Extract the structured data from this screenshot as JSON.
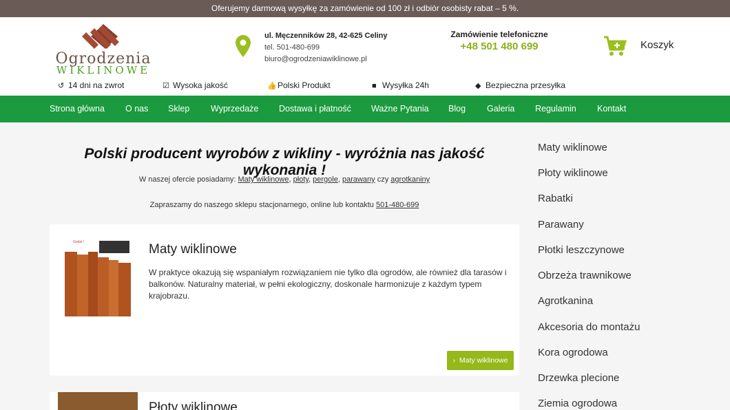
{
  "topbar": {
    "text": "Oferujemy darmową wysyłkę za zamówienie od 100 zł i odbiór osobisty rabat – 5 %."
  },
  "logo": {
    "line1": "Ogrodzenia",
    "line2": "WIKLINOWE"
  },
  "contact": {
    "address": "ul. Męczenników 28, 42-625 Celiny",
    "tel": "tel. 501-480-699",
    "email": "biuro@ogrodzeniawiklinowe.pl"
  },
  "phone": {
    "title": "Zamówienie telefoniczne",
    "number": "+48 501 480 699"
  },
  "cart": {
    "label": "Koszyk"
  },
  "features": [
    {
      "icon": "return-icon",
      "label": "14 dni na zwrot"
    },
    {
      "icon": "check-icon",
      "label": "Wysoka jakość"
    },
    {
      "icon": "thumb-up-icon",
      "label": "Polski Produkt"
    },
    {
      "icon": "truck-icon",
      "label": "Wysyłka 24h"
    },
    {
      "icon": "shield-icon",
      "label": "Bezpieczna przesyłka"
    }
  ],
  "nav": [
    "Strona główna",
    "O nas",
    "Sklep",
    "Wyprzedaże",
    "Dostawa i płatność",
    "Ważne Pytania",
    "Blog",
    "Galeria",
    "Regulamin",
    "Kontakt"
  ],
  "main": {
    "headline": "Polski producent wyrobów z wikliny - wyróżnia nas jakość wykonania !",
    "offer_prefix": "W naszej ofercie posiadamy: ",
    "offer_links": [
      "Maty wiklinowe",
      "płoty",
      "pergole",
      "parawany",
      "agrotkaniny"
    ],
    "offer_sep1": ", ",
    "offer_sep2": ", ",
    "offer_sep3": ", ",
    "offer_sep4": " czy ",
    "invite_prefix": "Zapraszamy do naszego sklepu stacjonarnego, online lub kontaktu ",
    "invite_link": "501-480-699"
  },
  "cards": [
    {
      "title": "Maty wiklinowe",
      "description": "W praktyce okazują się wspaniałym rozwiązaniem nie tylko dla ogrodów, ale również dla tarasów i balkonów. Naturalny materiał, w pełni ekologiczny, doskonale harmonizuje z każdym typem krajobrazu.",
      "button": "Maty wiklinowe",
      "image_label": "Gratis !"
    },
    {
      "title": "Płoty wiklinowe"
    }
  ],
  "sidebar": [
    "Maty wiklinowe",
    "Płoty wiklinowe",
    "Rabatki",
    "Parawany",
    "Płotki leszczynowe",
    "Obrzeża trawnikowe",
    "Agrotkanina",
    "Akcesoria do montażu",
    "Kora ogrodowa",
    "Drzewka plecione",
    "Ziemia ogrodowa"
  ],
  "colors": {
    "topbar": "#6b5b57",
    "nav": "#1b9a3f",
    "accent": "#96b81a",
    "phone": "#8ab11b"
  }
}
